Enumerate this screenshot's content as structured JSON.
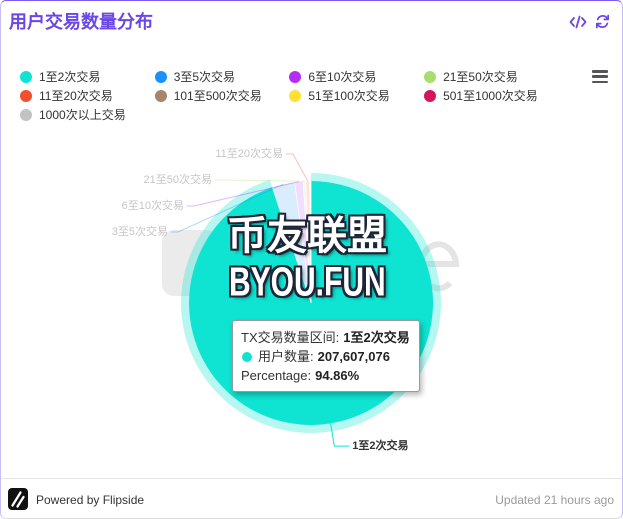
{
  "theme": {
    "accent": "#6A45E8"
  },
  "icons": {
    "embed": "code-icon",
    "refresh": "refresh-icon",
    "legend_menu": "menu-icon",
    "footer_logo": "flipside-logo"
  },
  "chart_data": {
    "type": "pie",
    "title": "用户交易数量分布",
    "categories": [
      "1至2次交易",
      "3至5次交易",
      "6至10次交易",
      "21至50次交易",
      "11至20次交易",
      "101至500次交易",
      "51至100次交易",
      "501至1000次交易",
      "1000次以上交易"
    ],
    "values": [
      207607076,
      6566000,
      2407000,
      766000,
      1094000,
      219000,
      131000,
      44000,
      22000
    ],
    "colors": [
      "#0FE3D2",
      "#1890FF",
      "#B32DF6",
      "#A8DE6E",
      "#F0502D",
      "#A6856A",
      "#FFE033",
      "#D6145C",
      "#C2C2C2"
    ],
    "highlighted": "1至2次交易",
    "legend_position": "top"
  },
  "tooltip": {
    "category_label": "TX交易数量区间:",
    "value_label": "用户数量:",
    "value": "207,607,076",
    "percent_label": "Percentage:",
    "percent_value": "94.86%"
  },
  "watermark": {
    "line1": "币友联盟",
    "line2": "BYOU.FUN"
  },
  "footer": {
    "powered_by": "Powered by Flipside",
    "updated": "Updated 21 hours ago"
  }
}
